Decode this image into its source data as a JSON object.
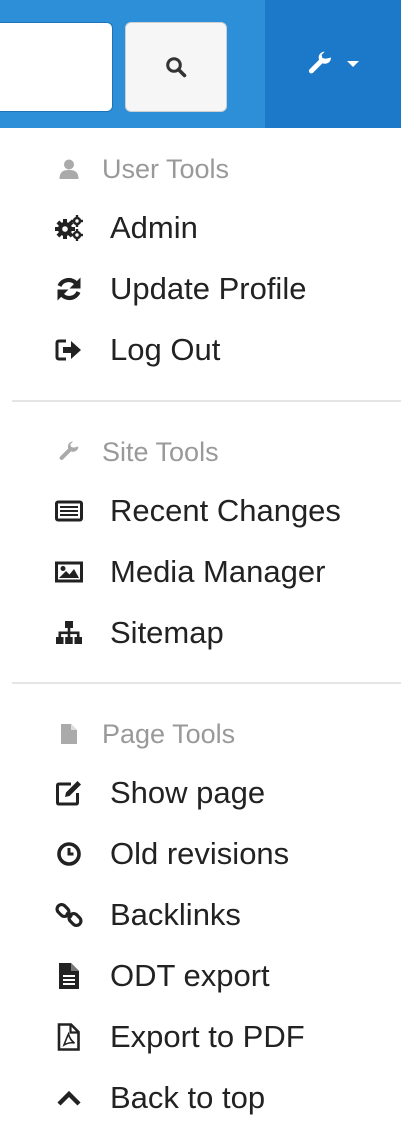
{
  "navbar": {
    "search_placeholder": "",
    "search_button_icon": "search-icon",
    "tools_icon": "wrench-icon",
    "tools_caret_icon": "caret-down-icon",
    "bg_color": "#2d8fd8",
    "tools_bg_color": "#1c78c8"
  },
  "menu": {
    "user_tools": {
      "header": "User Tools",
      "icon": "user-icon",
      "items": [
        {
          "label": "Admin",
          "icon": "cogs-icon"
        },
        {
          "label": "Update Profile",
          "icon": "refresh-icon"
        },
        {
          "label": "Log Out",
          "icon": "sign-out-icon"
        }
      ]
    },
    "site_tools": {
      "header": "Site Tools",
      "icon": "wrench-icon",
      "items": [
        {
          "label": "Recent Changes",
          "icon": "list-icon"
        },
        {
          "label": "Media Manager",
          "icon": "image-icon"
        },
        {
          "label": "Sitemap",
          "icon": "sitemap-icon"
        }
      ]
    },
    "page_tools": {
      "header": "Page Tools",
      "icon": "file-icon",
      "items": [
        {
          "label": "Show page",
          "icon": "edit-icon"
        },
        {
          "label": "Old revisions",
          "icon": "clock-icon"
        },
        {
          "label": "Backlinks",
          "icon": "link-icon"
        },
        {
          "label": "ODT export",
          "icon": "file-text-icon"
        },
        {
          "label": "Export to PDF",
          "icon": "pdf-icon"
        },
        {
          "label": "Back to top",
          "icon": "chevron-up-icon"
        }
      ]
    }
  }
}
